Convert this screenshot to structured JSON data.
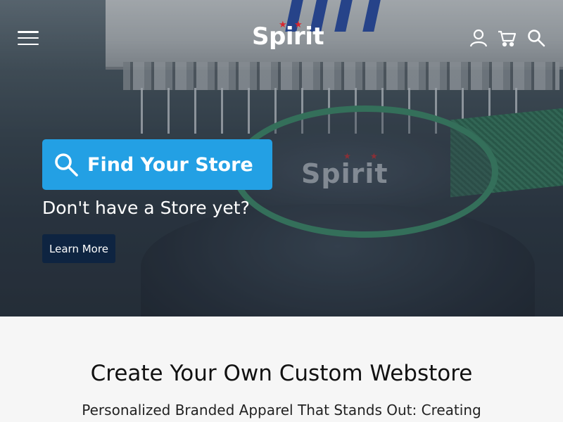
{
  "header": {
    "logo_text": "Spirit",
    "menu_icon": "hamburger-menu-icon",
    "account_icon": "user-icon",
    "cart_icon": "cart-icon",
    "search_icon": "search-icon"
  },
  "hero": {
    "find_store_label": "Find Your Store",
    "find_store_icon": "search-icon",
    "no_store_text": "Don't have a Store yet?",
    "learn_more_label": "Learn More",
    "embroidery_text": "Spirit"
  },
  "section": {
    "title": "Create Your Own Custom Webstore",
    "subtitle": "Personalized Branded Apparel That Stands Out: Creating"
  },
  "colors": {
    "find_store_bg": "#23a0e4",
    "learn_more_bg": "#0e2441",
    "logo_star": "#d8262e",
    "section_bg": "#f6f6f6"
  }
}
